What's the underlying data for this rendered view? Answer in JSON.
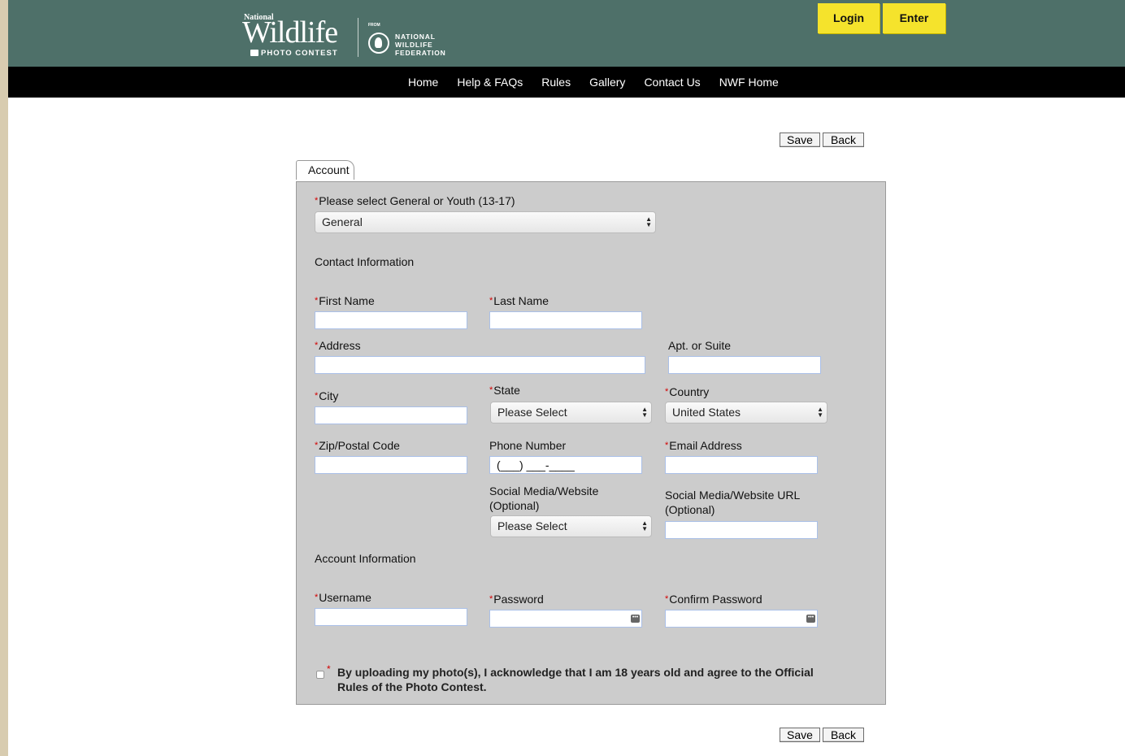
{
  "header": {
    "logo": {
      "national": "National",
      "wildlife": "Wildlife",
      "photo_contest": "PHOTO CONTEST",
      "from": "FROM",
      "federation": "NATIONAL WILDLIFE FEDERATION"
    },
    "login_label": "Login",
    "enter_label": "Enter"
  },
  "nav": {
    "items": [
      "Home",
      "Help & FAQs",
      "Rules",
      "Gallery",
      "Contact Us",
      "NWF Home"
    ]
  },
  "actions": {
    "save_label": "Save",
    "back_label": "Back"
  },
  "tab": {
    "label": "Account"
  },
  "form": {
    "category": {
      "label": "Please select General or Youth (13-17)",
      "value": "General"
    },
    "contact_section": "Contact Information",
    "first_name": {
      "label": "First Name",
      "value": ""
    },
    "last_name": {
      "label": "Last Name",
      "value": ""
    },
    "address": {
      "label": "Address",
      "value": ""
    },
    "apt": {
      "label": "Apt. or Suite",
      "value": ""
    },
    "city": {
      "label": "City",
      "value": ""
    },
    "state": {
      "label": "State",
      "value": "Please Select"
    },
    "country": {
      "label": "Country",
      "value": "United States"
    },
    "zip": {
      "label": "Zip/Postal Code",
      "value": ""
    },
    "phone": {
      "label": "Phone Number",
      "value": "(___) ___-____"
    },
    "email": {
      "label": "Email Address",
      "value": ""
    },
    "social": {
      "label_line1": "Social Media/Website",
      "label_line2": "(Optional)",
      "value": "Please Select"
    },
    "social_url": {
      "label_line1": "Social Media/Website URL",
      "label_line2": "(Optional)",
      "value": ""
    },
    "account_section": "Account Information",
    "username": {
      "label": "Username",
      "value": ""
    },
    "password": {
      "label": "Password",
      "value": ""
    },
    "confirm_password": {
      "label": "Confirm Password",
      "value": ""
    },
    "acknowledge": "By uploading my photo(s), I acknowledge that I am 18 years old and agree to the Official Rules of the Photo Contest."
  },
  "required_marker": "*",
  "colors": {
    "header_bg": "#4e7069",
    "nav_bg": "#000000",
    "button_yellow": "#f5e32c",
    "panel_bg": "#cccccc",
    "required": "#d20000"
  }
}
